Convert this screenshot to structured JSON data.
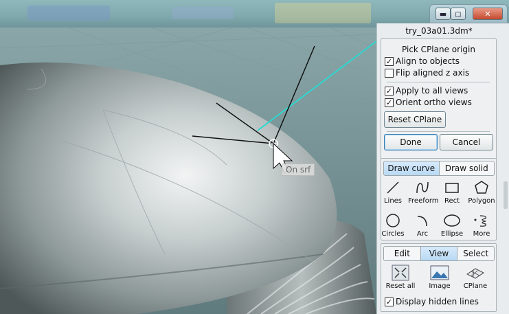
{
  "window": {
    "minimize": "▬",
    "maximize": "◻",
    "close": "✕"
  },
  "viewport": {
    "snap_tooltip": "On srf"
  },
  "panel": {
    "doc_title": "try_03a01.3dm*",
    "command": {
      "prompt": "Pick CPlane origin",
      "align_to_objects": {
        "label": "Align to objects",
        "checked": true
      },
      "flip_aligned_z": {
        "label": "Flip aligned z axis",
        "checked": false
      },
      "apply_to_all_views": {
        "label": "Apply to all views",
        "checked": true
      },
      "orient_ortho_views": {
        "label": "Orient ortho views",
        "checked": true
      },
      "reset_cplane": "Reset CPlane",
      "done": "Done",
      "cancel": "Cancel"
    },
    "draw": {
      "tabs": [
        {
          "label": "Draw curve",
          "active": true
        },
        {
          "label": "Draw solid",
          "active": false
        }
      ],
      "tools": [
        {
          "label": "Lines",
          "icon": "line-icon"
        },
        {
          "label": "Freeform",
          "icon": "freeform-curve-icon"
        },
        {
          "label": "Rect",
          "icon": "rectangle-icon"
        },
        {
          "label": "Polygon",
          "icon": "polygon-icon"
        },
        {
          "label": "Circles",
          "icon": "circle-icon"
        },
        {
          "label": "Arc",
          "icon": "arc-icon"
        },
        {
          "label": "Ellipse",
          "icon": "ellipse-icon"
        },
        {
          "label": "More",
          "icon": "more-spiral-icon"
        }
      ]
    },
    "view": {
      "tabs": [
        {
          "label": "Edit",
          "active": false
        },
        {
          "label": "View",
          "active": true
        },
        {
          "label": "Select",
          "active": false
        }
      ],
      "tools": [
        {
          "label": "Reset all",
          "icon": "reset-all-icon"
        },
        {
          "label": "Image",
          "icon": "image-icon"
        },
        {
          "label": "CPlane",
          "icon": "cplane-icon"
        }
      ],
      "display_hidden_lines": {
        "label": "Display hidden lines",
        "checked": true
      }
    }
  },
  "colors": {
    "active_tab": "#b9d9f4",
    "cyan_axis": "#2fd6d0"
  }
}
